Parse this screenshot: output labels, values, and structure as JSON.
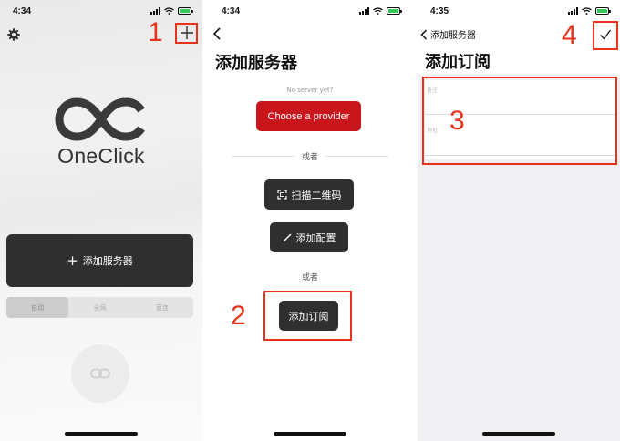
{
  "panel1": {
    "time": "4:34",
    "logo_text": "OneClick",
    "add_server_label": "添加服务器",
    "plus_glyph": "+",
    "modes": [
      "自动",
      "全局",
      "直连"
    ],
    "active_mode": "自动",
    "step_label": "1"
  },
  "panel2": {
    "time": "4:34",
    "title": "添加服务器",
    "no_server": "No server yet?",
    "provider_button": "Choose a provider",
    "or_1": "或者",
    "scan_qr": "扫描二维码",
    "add_config": "添加配置",
    "or_2": "或者",
    "add_subscription": "添加订阅",
    "step_label": "2"
  },
  "panel3": {
    "time": "4:35",
    "back_label": "添加服务器",
    "title": "添加订阅",
    "field_remark": "备注",
    "field_address": "地址",
    "step_label_form": "3",
    "step_label_confirm": "4"
  },
  "colors": {
    "annotation": "#e8331c",
    "provider_red": "#c9151c",
    "dark_button": "#2f2f2f",
    "battery_green": "#35c759"
  },
  "icons": [
    "gear-icon",
    "plus-icon",
    "infinity-logo-icon",
    "link-icon",
    "back-chevron-icon",
    "qr-scan-icon",
    "pencil-icon",
    "checkmark-icon",
    "signal-icon",
    "wifi-icon",
    "battery-icon"
  ]
}
